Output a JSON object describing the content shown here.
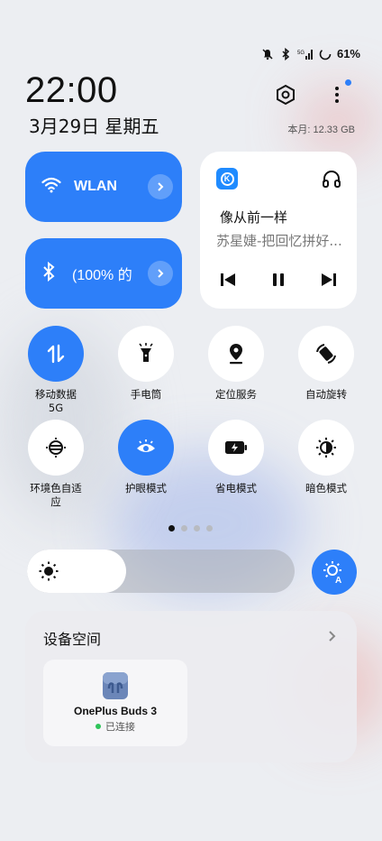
{
  "status_bar": {
    "battery_percent": "61%",
    "icons": [
      "mute-icon",
      "bluetooth-icon",
      "5g-signal-icon",
      "battery-icon"
    ]
  },
  "header": {
    "time": "22:00",
    "date": "3月29日 星期五",
    "storage": "本月: 12.33 GB"
  },
  "tiles": {
    "wlan_label": "WLAN",
    "bluetooth_label": "(100% 的"
  },
  "media": {
    "song_title": "像从前一样",
    "artist": "苏星婕-把回忆拼好..."
  },
  "toggles_row1": [
    {
      "label": "移动数据\n5G",
      "on": true
    },
    {
      "label": "手电筒",
      "on": false
    },
    {
      "label": "定位服务",
      "on": false
    },
    {
      "label": "自动旋转",
      "on": false
    }
  ],
  "toggles_row2": [
    {
      "label": "环境色自适\n应",
      "on": false
    },
    {
      "label": "护眼模式",
      "on": true
    },
    {
      "label": "省电模式",
      "on": false
    },
    {
      "label": "暗色模式",
      "on": false
    }
  ],
  "labels": {
    "t1a": "移动数据",
    "t1b": "5G",
    "t2": "手电筒",
    "t3": "定位服务",
    "t4": "自动旋转",
    "t5a": "环境色自适",
    "t5b": "应",
    "t6": "护眼模式",
    "t7": "省电模式",
    "t8": "暗色模式"
  },
  "pager": {
    "pages": 4,
    "active_index": 0
  },
  "brightness": {
    "level": 0.37
  },
  "device_space": {
    "title": "设备空间",
    "device_name": "OnePlus Buds 3",
    "device_status": "已连接"
  },
  "colors": {
    "accent": "#2d7ff9",
    "connected": "#2ec45a"
  }
}
